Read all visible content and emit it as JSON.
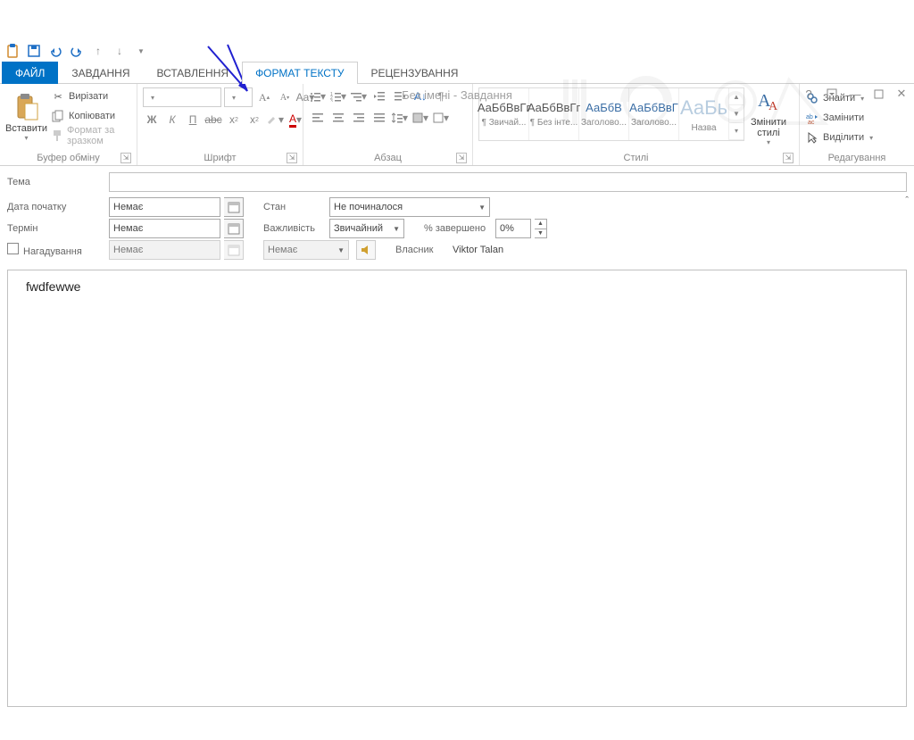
{
  "title": "Без імені - Завдання",
  "tabs": {
    "file": "ФАЙЛ",
    "task": "ЗАВДАННЯ",
    "insert": "ВСТАВЛЕННЯ",
    "format": "ФОРМАТ ТЕКСТУ",
    "review": "РЕЦЕНЗУВАННЯ"
  },
  "ribbon": {
    "clipboard": {
      "label": "Буфер обміну",
      "paste": "Вставити",
      "cut": "Вирізати",
      "copy": "Копіювати",
      "format_painter": "Формат за зразком"
    },
    "font": {
      "label": "Шрифт"
    },
    "paragraph": {
      "label": "Абзац"
    },
    "styles": {
      "label": "Стилі",
      "items": [
        {
          "sample": "АаБбВвГг",
          "name": "¶ Звичай..."
        },
        {
          "sample": "АаБбВвГг",
          "name": "¶ Без інте..."
        },
        {
          "sample": "АаБбВ",
          "name": "Заголово..."
        },
        {
          "sample": "АаБбВвГ",
          "name": "Заголово..."
        },
        {
          "sample": "АаБь",
          "name": "Назва"
        }
      ],
      "change": "Змінити стилі"
    },
    "editing": {
      "label": "Редагування",
      "find": "Знайти",
      "replace": "Замінити",
      "select": "Виділити"
    }
  },
  "form": {
    "subject_label": "Тема",
    "subject_value": "",
    "start_label": "Дата початку",
    "start_value": "Немає",
    "state_label": "Стан",
    "state_value": "Не починалося",
    "due_label": "Термін",
    "due_value": "Немає",
    "priority_label": "Важливість",
    "priority_value": "Звичайний",
    "percent_label": "% завершено",
    "percent_value": "0%",
    "reminder_label": "Нагадування",
    "reminder_date": "Немає",
    "reminder_time": "Немає",
    "owner_label": "Власник",
    "owner_value": "Viktor Talan"
  },
  "body_text": "fwdfewwe"
}
